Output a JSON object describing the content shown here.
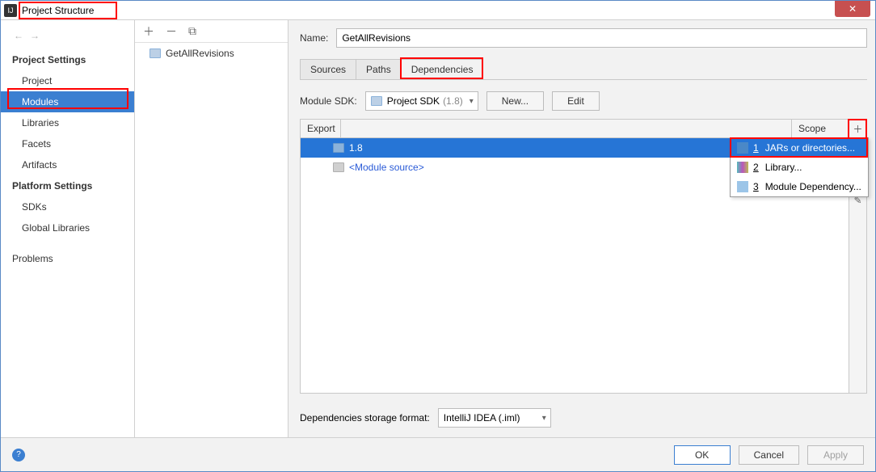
{
  "window": {
    "title": "Project Structure"
  },
  "sidebar": {
    "cat1": "Project Settings",
    "items1": [
      "Project",
      "Modules",
      "Libraries",
      "Facets",
      "Artifacts"
    ],
    "cat2": "Platform Settings",
    "items2": [
      "SDKs",
      "Global Libraries"
    ],
    "items3": [
      "Problems"
    ]
  },
  "tree": {
    "module": "GetAllRevisions"
  },
  "main": {
    "name_label": "Name:",
    "name_value": "GetAllRevisions",
    "tabs": [
      "Sources",
      "Paths",
      "Dependencies"
    ],
    "sdk_label": "Module SDK:",
    "sdk_value_prefix": "Project SDK",
    "sdk_value_suffix": "(1.8)",
    "btn_new": "New...",
    "btn_edit": "Edit",
    "col_export": "Export",
    "col_scope": "Scope",
    "row1": "1.8",
    "row2": "<Module source>",
    "storage_label": "Dependencies storage format:",
    "storage_value": "IntelliJ IDEA (.iml)"
  },
  "popup": {
    "items": [
      {
        "num": "1",
        "label": "JARs or directories..."
      },
      {
        "num": "2",
        "label": "Library..."
      },
      {
        "num": "3",
        "label": "Module Dependency..."
      }
    ]
  },
  "bottom": {
    "ok": "OK",
    "cancel": "Cancel",
    "apply": "Apply"
  }
}
